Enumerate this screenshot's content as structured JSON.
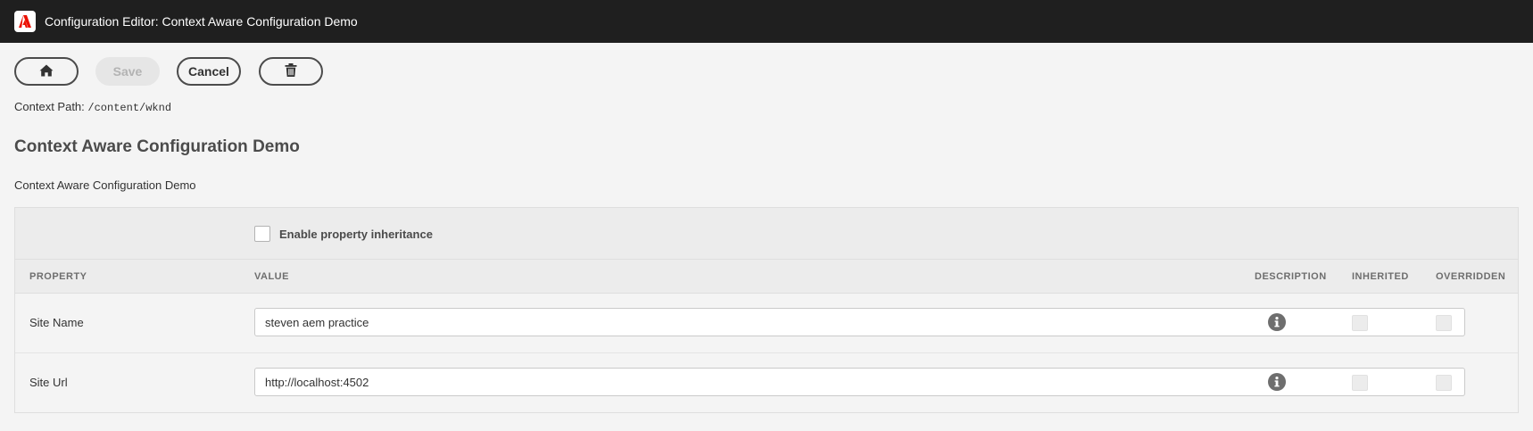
{
  "app": {
    "title": "Configuration Editor: Context Aware Configuration Demo"
  },
  "toolbar": {
    "home_icon": "home-icon",
    "save_label": "Save",
    "save_disabled": true,
    "cancel_label": "Cancel",
    "delete_icon": "trash-icon"
  },
  "context": {
    "label": "Context Path:",
    "path": "/content/wknd"
  },
  "page": {
    "title": "Context Aware Configuration Demo",
    "description": "Context Aware Configuration Demo"
  },
  "inheritance": {
    "label": "Enable property inheritance",
    "checked": false
  },
  "table": {
    "columns": {
      "property": "PROPERTY",
      "value": "VALUE",
      "description": "DESCRIPTION",
      "inherited": "INHERITED",
      "overridden": "OVERRIDDEN"
    },
    "rows": [
      {
        "property": "Site Name",
        "value": "steven aem practice",
        "description_icon": "info-icon",
        "inherited": false,
        "overridden": false
      },
      {
        "property": "Site Url",
        "value": "http://localhost:4502",
        "description_icon": "info-icon",
        "inherited": false,
        "overridden": false
      }
    ]
  },
  "colors": {
    "topbar": "#1f1f1f",
    "background": "#f4f4f4",
    "brand": "#eb1000"
  }
}
